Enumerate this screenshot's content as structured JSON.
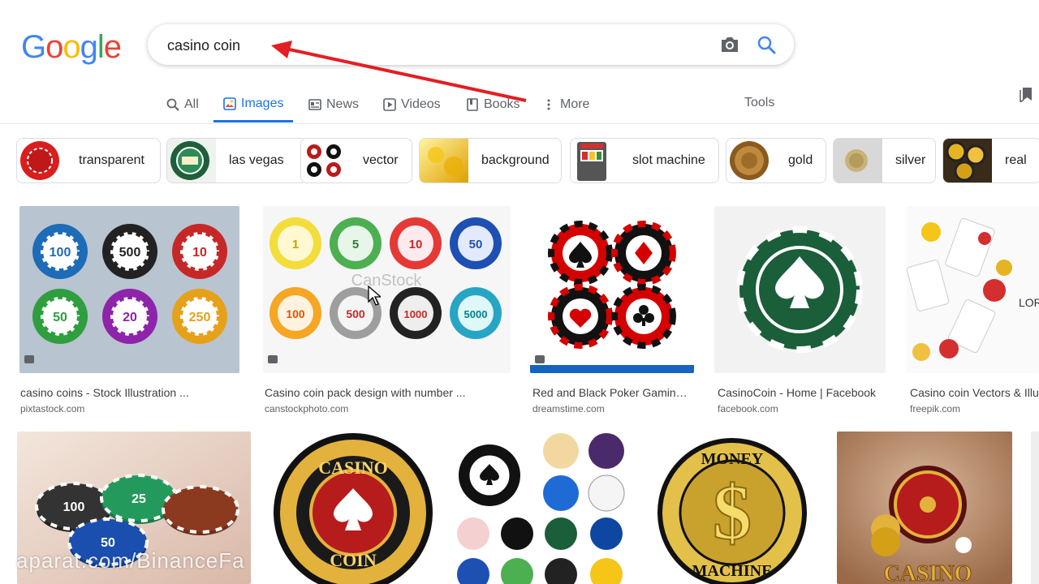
{
  "logo": {
    "letters": [
      "G",
      "o",
      "o",
      "g",
      "l",
      "e"
    ],
    "colors": [
      "#4285F4",
      "#EA4335",
      "#FBBC05",
      "#4285F4",
      "#34A853",
      "#EA4335"
    ]
  },
  "search": {
    "query": "casino coin",
    "camera_icon": "camera-icon",
    "search_icon": "search-icon"
  },
  "tabs": [
    {
      "label": "All",
      "icon": "search-icon"
    },
    {
      "label": "Images",
      "icon": "image-icon",
      "active": true
    },
    {
      "label": "News",
      "icon": "news-icon"
    },
    {
      "label": "Videos",
      "icon": "play-icon"
    },
    {
      "label": "Books",
      "icon": "book-icon"
    },
    {
      "label": "More",
      "icon": "more-vert-icon"
    }
  ],
  "tools_label": "Tools",
  "chips": [
    {
      "label": "transparent"
    },
    {
      "label": "las vegas"
    },
    {
      "label": "vector"
    },
    {
      "label": "background"
    },
    {
      "label": "slot machine"
    },
    {
      "label": "gold"
    },
    {
      "label": "silver"
    },
    {
      "label": "real"
    }
  ],
  "results_row1": [
    {
      "title": "casino coins - Stock Illustration ...",
      "site": "pixtastock.com",
      "chips": [
        "100",
        "500",
        "10",
        "50",
        "20",
        "250"
      ]
    },
    {
      "title": "Casino coin pack design with number ...",
      "site": "canstockphoto.com",
      "chips": [
        "1",
        "5",
        "10",
        "50",
        "100",
        "500",
        "1000",
        "5000"
      ],
      "watermark": "CanStock"
    },
    {
      "title": "Red and Black Poker Gaming...",
      "site": "dreamstime.com"
    },
    {
      "title": "CasinoCoin - Home | Facebook",
      "site": "facebook.com"
    },
    {
      "title": "Casino coin Vectors & Illu",
      "site": "freepik.com"
    }
  ],
  "results_row2": [
    {
      "chips": [
        "100",
        "25",
        "50"
      ]
    },
    {
      "text_top": "CASINO",
      "text_bottom": "COIN"
    },
    {},
    {
      "text_top": "MONEY",
      "text_bottom": "MACHINE"
    },
    {
      "text": "CASINO"
    }
  ],
  "overlay_watermark": "aparat.com/BinanceFa"
}
